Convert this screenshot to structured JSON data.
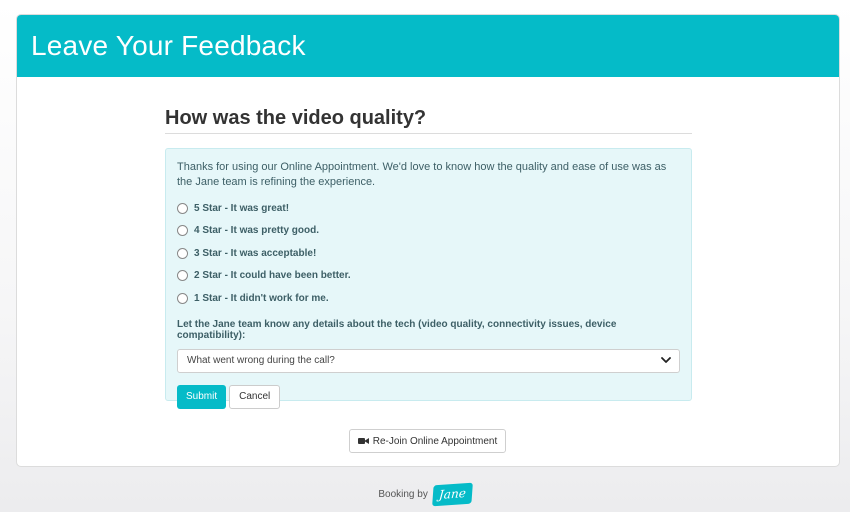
{
  "header": {
    "title": "Leave Your Feedback"
  },
  "main": {
    "question": "How was the video quality?",
    "intro": "Thanks for using our Online Appointment. We'd love to know how the quality and ease of use was as the Jane team is refining the experience.",
    "options": [
      "5 Star - It was great!",
      "4 Star - It was pretty good.",
      "3 Star - It was acceptable!",
      "2 Star - It could have been better.",
      "1 Star - It didn't work for me."
    ],
    "details_label": "Let the Jane team know any details about the tech (video quality, connectivity issues, device compatibility):",
    "select_value": "What went wrong during the call?",
    "submit_label": "Submit",
    "cancel_label": "Cancel",
    "rejoin_label": "Re-Join Online Appointment"
  },
  "footer": {
    "booking_by": "Booking by",
    "logo_text": "Jane"
  },
  "colors": {
    "accent": "#05bbc8",
    "panel_bg": "#e6f7f9"
  },
  "icons": {
    "select": "chevron-down-icon",
    "rejoin": "video-camera-icon"
  }
}
